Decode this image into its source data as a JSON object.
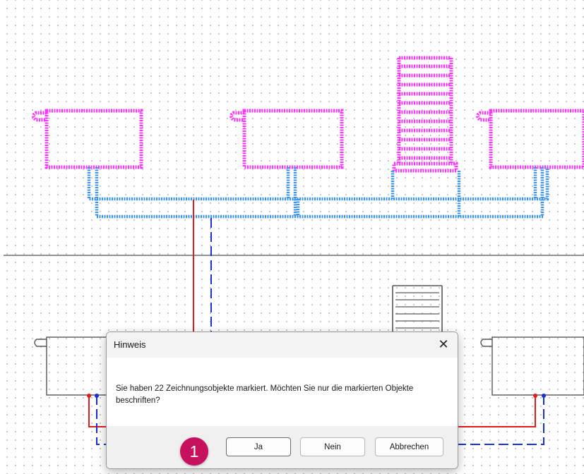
{
  "dialog": {
    "title": "Hinweis",
    "close_glyph": "✕",
    "message": "Sie haben 22 Zeichnungsobjekte markiert. Möchten Sie nur die markierten Objekte beschriften?",
    "buttons": {
      "yes": "Ja",
      "no": "Nein",
      "cancel": "Abbrechen"
    }
  },
  "callout": {
    "number": "1"
  },
  "colors": {
    "selection_magenta": "#ff33ff",
    "selection_blue": "#3c96f0",
    "supply_red": "#e31b1b",
    "return_blue": "#1a2fd6",
    "floor_line": "#6e6e6e",
    "callout_badge": "#c8115d"
  },
  "icons": {
    "close": "close-icon"
  }
}
